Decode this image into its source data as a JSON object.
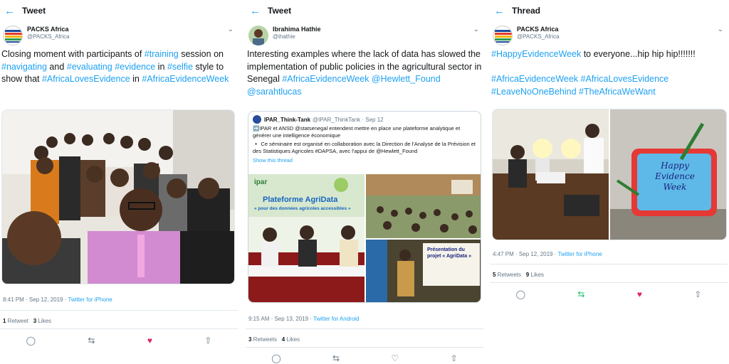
{
  "colors": {
    "accent": "#1da1f2",
    "like": "#e0245e",
    "retweet_active": "#17bf63",
    "muted": "#657786"
  },
  "icons": {
    "back": "arrow-left-icon",
    "more": "chevron-down-icon",
    "reply": "reply-icon",
    "retweet": "retweet-icon",
    "like": "heart-icon",
    "share": "share-icon"
  },
  "panel1": {
    "bar_title": "Tweet",
    "display_name": "PACKS Africa",
    "handle": "@PACKS_Africa",
    "avatar_text": "Knowledge Management Research",
    "text_parts": [
      {
        "t": "Closing moment with participants of ",
        "tag": false
      },
      {
        "t": "#training",
        "tag": true
      },
      {
        "t": " session on ",
        "tag": false
      },
      {
        "t": "#navigating",
        "tag": true
      },
      {
        "t": " and ",
        "tag": false
      },
      {
        "t": "#evaluating",
        "tag": true
      },
      {
        "t": " ",
        "tag": false
      },
      {
        "t": "#evidence",
        "tag": true
      },
      {
        "t": " in ",
        "tag": false
      },
      {
        "t": "#selfie",
        "tag": true
      },
      {
        "t": " style to show that ",
        "tag": false
      },
      {
        "t": "#AfricaLovesEvidence",
        "tag": true
      },
      {
        "t": " in ",
        "tag": false
      },
      {
        "t": "#AfricaEvidenceWeek",
        "tag": true
      }
    ],
    "time": "8:41 PM · Sep 12, 2019 · ",
    "source": "Twitter for iPhone",
    "retweets_num": "1",
    "retweets_label": " Retweet",
    "likes_num": "3",
    "likes_label": " Likes"
  },
  "panel2": {
    "bar_title": "Tweet",
    "display_name": "Ibrahima Hathie",
    "handle": "@ihathie",
    "text_parts": [
      {
        "t": "Interesting examples where the lack of data has slowed the implementation of public policies in the agricultural sector in Senegal ",
        "tag": false
      },
      {
        "t": "#AfricaEvidenceWeek",
        "tag": true
      },
      {
        "t": " ",
        "tag": false
      },
      {
        "t": "@Hewlett_Found",
        "tag": true
      },
      {
        "t": " ",
        "tag": false
      },
      {
        "t": "@sarahtlucas",
        "tag": true
      }
    ],
    "quote": {
      "name": "IPAR_Think-Tank",
      "handle": "@IPAR_ThinkTank · Sep 12",
      "line1": "➡️IPAR et ANSD @statsenegal entendent mettre en place une plateforme analytique et générer une intelligence économique",
      "line2": "▪️ Ce séminaire est organisé en collaboration avec la Direction de l'Analyse de la Prévision et des Statistiques Agricoles #DAPSA, avec l'appui de @Hewlett_Found",
      "link": "Show this thread",
      "banner_brand": "ipar",
      "banner_title": "Plateforme AgriData",
      "banner_sub": "« pour des données agricoles accessibles »",
      "screen_text": "Présentation du projet « AgriData »"
    },
    "time": "9:15 AM · Sep 13, 2019 · ",
    "source": "Twitter for Android",
    "retweets_num": "3",
    "retweets_label": " Retweets",
    "likes_num": "4",
    "likes_label": " Likes"
  },
  "panel3": {
    "bar_title": "Thread",
    "display_name": "PACKS Africa",
    "handle": "@PACKS_Africa",
    "text_parts": [
      {
        "t": "#HappyEvidenceWeek",
        "tag": true
      },
      {
        "t": " to everyone...hip hip hip!!!!!!!",
        "tag": false
      },
      {
        "t": "\n\n",
        "tag": false
      },
      {
        "t": "#AfricaEvidenceWeek",
        "tag": true
      },
      {
        "t": " ",
        "tag": false
      },
      {
        "t": "#AfricaLovesEvidence",
        "tag": true
      },
      {
        "t": " ",
        "tag": false
      },
      {
        "t": "#LeaveNoOneBehind",
        "tag": true
      },
      {
        "t": " ",
        "tag": false
      },
      {
        "t": "#TheAfricaWeWant",
        "tag": true
      }
    ],
    "cake_text": "Happy Evidence Week",
    "time": "4:47 PM · Sep 12, 2019 · ",
    "source": "Twitter for iPhone",
    "retweets_num": "5",
    "retweets_label": " Retweets",
    "likes_num": "9",
    "likes_label": " Likes"
  }
}
